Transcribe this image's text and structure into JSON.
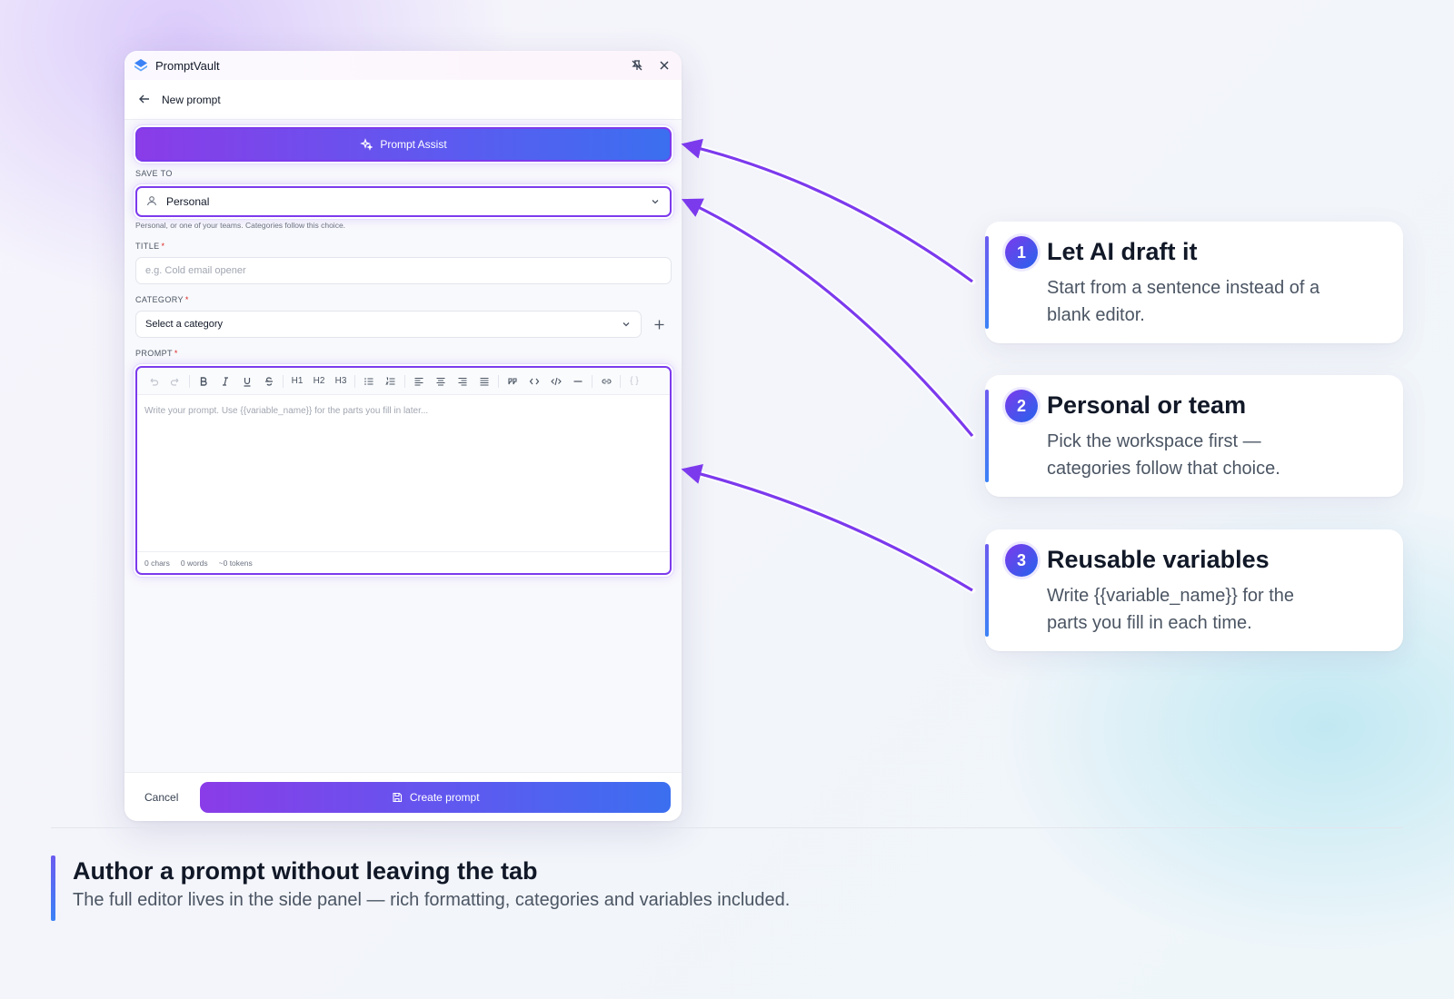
{
  "window": {
    "app_name": "PromptVault",
    "brand_color": "#7c3aed"
  },
  "nav": {
    "title": "New prompt"
  },
  "form": {
    "assist_label": "Prompt Assist",
    "save_to": {
      "label": "SAVE TO",
      "value": "Personal",
      "helper": "Personal, or one of your teams. Categories follow this choice."
    },
    "title": {
      "label": "TITLE",
      "required_mark": "*",
      "placeholder": "e.g. Cold email opener",
      "value": ""
    },
    "category": {
      "label": "CATEGORY",
      "required_mark": "*",
      "value": "Select a category"
    },
    "prompt": {
      "label": "PROMPT",
      "required_mark": "*",
      "placeholder": "Write your prompt. Use {{variable_name}} for the parts you fill in later...",
      "toolbar_heading_labels": [
        "H1",
        "H2",
        "H3"
      ],
      "toolbar_variable_label": "{ }",
      "counts": {
        "chars": "0 chars",
        "words": "0 words",
        "tokens": "~0 tokens"
      }
    },
    "cancel_label": "Cancel",
    "create_label": "Create prompt"
  },
  "callouts": [
    {
      "number": "1",
      "title": "Let AI draft it",
      "body": "Start from a sentence instead of a blank editor."
    },
    {
      "number": "2",
      "title": "Personal or team",
      "body": "Pick the workspace first — categories follow that choice."
    },
    {
      "number": "3",
      "title": "Reusable variables",
      "body": "Write {{variable_name}} for the parts you fill in each time."
    }
  ],
  "caption": {
    "title": "Author a prompt without leaving the tab",
    "subtitle": "The full editor lives in the side panel — rich formatting, categories and variables included."
  },
  "colors": {
    "accent_purple": "#7c3aed",
    "accent_blue": "#3b6ff0",
    "required": "#dc2626"
  }
}
